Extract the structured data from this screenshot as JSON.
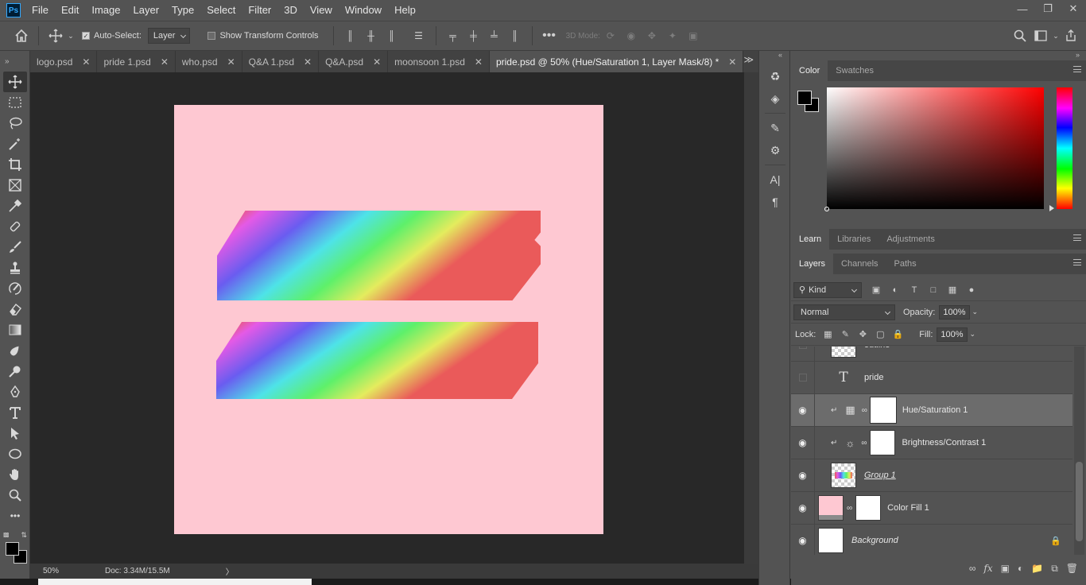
{
  "app": {
    "logo": "Ps"
  },
  "menu": [
    "File",
    "Edit",
    "Image",
    "Layer",
    "Type",
    "Select",
    "Filter",
    "3D",
    "View",
    "Window",
    "Help"
  ],
  "options": {
    "auto_select_label": "Auto-Select:",
    "auto_select_checked": true,
    "layer_select": "Layer",
    "show_transform_label": "Show Transform Controls",
    "mode_3d_label": "3D Mode:"
  },
  "tabs": [
    {
      "label": "logo.psd",
      "active": false
    },
    {
      "label": "pride 1.psd",
      "active": false
    },
    {
      "label": "who.psd",
      "active": false
    },
    {
      "label": "Q&A 1.psd",
      "active": false
    },
    {
      "label": "Q&A.psd",
      "active": false
    },
    {
      "label": "moonsoon 1.psd",
      "active": false
    },
    {
      "label": "pride.psd @ 50% (Hue/Saturation 1, Layer Mask/8) *",
      "active": true
    }
  ],
  "status": {
    "zoom": "50%",
    "doc": "Doc: 3.34M/15.5M"
  },
  "canvas": {
    "background_color": "#fec8d2"
  },
  "color_panel": {
    "tabs": [
      "Color",
      "Swatches"
    ],
    "active_tab": "Color",
    "foreground": "#000000",
    "background": "#000000"
  },
  "learn_panel": {
    "tabs": [
      "Learn",
      "Libraries",
      "Adjustments"
    ],
    "active_tab": "Learn"
  },
  "layers_panel": {
    "tabs": [
      "Layers",
      "Channels",
      "Paths"
    ],
    "active_tab": "Layers",
    "filter_kind": "Kind",
    "blend_mode": "Normal",
    "opacity_label": "Opacity:",
    "opacity": "100%",
    "lock_label": "Lock:",
    "fill_label": "Fill:",
    "fill": "100%",
    "layers": [
      {
        "name": "outline",
        "visible": false,
        "kind": "pixel-partial"
      },
      {
        "name": "pride",
        "visible": false,
        "kind": "text"
      },
      {
        "name": "Hue/Saturation 1",
        "visible": true,
        "kind": "adjustment-hue",
        "selected": true
      },
      {
        "name": "Brightness/Contrast 1",
        "visible": true,
        "kind": "adjustment-brightness"
      },
      {
        "name": "Group 1",
        "visible": true,
        "kind": "pixel"
      },
      {
        "name": "Color Fill 1",
        "visible": true,
        "kind": "fill"
      },
      {
        "name": "Background",
        "visible": true,
        "kind": "background"
      }
    ]
  }
}
